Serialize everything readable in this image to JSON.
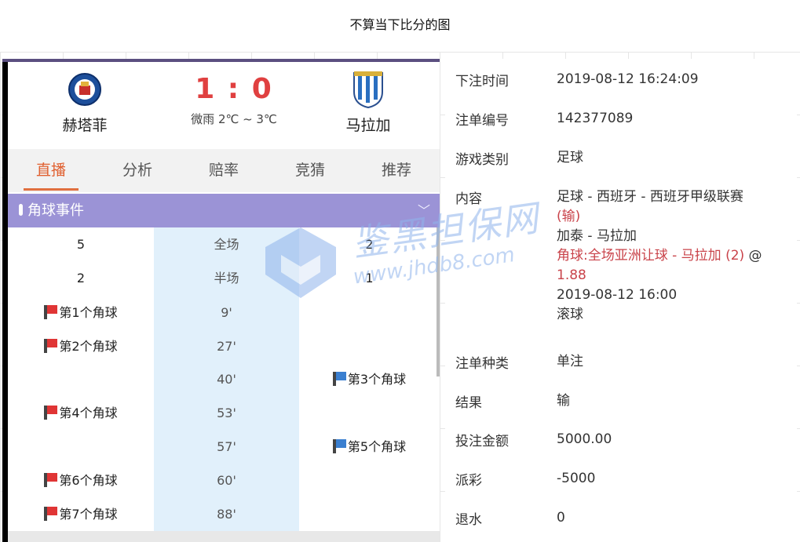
{
  "caption": "不算当下比分的图",
  "match": {
    "home_team": "赫塔菲",
    "away_team": "马拉加",
    "score": "1 : 0",
    "weather": "微雨  2℃ ~ 3℃"
  },
  "tabs": [
    {
      "label": "直播",
      "active": true
    },
    {
      "label": "分析",
      "active": false
    },
    {
      "label": "赔率",
      "active": false
    },
    {
      "label": "竞猜",
      "active": false
    },
    {
      "label": "推荐",
      "active": false
    }
  ],
  "section": {
    "title": "角球事件"
  },
  "corner_rows": [
    {
      "left": "5",
      "mid": "全场",
      "right": "2"
    },
    {
      "left": "2",
      "mid": "半场",
      "right": "1"
    },
    {
      "left_flag": "red",
      "left": "第1个角球",
      "mid": "9'",
      "right": ""
    },
    {
      "left_flag": "red",
      "left": "第2个角球",
      "mid": "27'",
      "right": ""
    },
    {
      "left": "",
      "mid": "40'",
      "right_flag": "blue",
      "right": "第3个角球"
    },
    {
      "left_flag": "red",
      "left": "第4个角球",
      "mid": "53'",
      "right": ""
    },
    {
      "left": "",
      "mid": "57'",
      "right_flag": "blue",
      "right": "第5个角球"
    },
    {
      "left_flag": "red",
      "left": "第6个角球",
      "mid": "60'",
      "right": ""
    },
    {
      "left_flag": "red",
      "left": "第7个角球",
      "mid": "88'",
      "right": ""
    }
  ],
  "watermark": {
    "text": "鉴黑担保网",
    "url": "www.jhdb8.com"
  },
  "bet": {
    "time_label": "下注时间",
    "time": "2019-08-12 16:24:09",
    "id_label": "注单编号",
    "id": "142377089",
    "game_label": "游戏类别",
    "game": "足球",
    "content_label": "内容",
    "content_league": "足球 - 西班牙 - 西班牙甲级联赛",
    "content_result": "(输)",
    "content_match": "加泰 - 马拉加",
    "content_pick": "角球:全场亚洲让球 - 马拉加 (2)",
    "content_at": " @",
    "content_odds": "1.88",
    "content_date": "2019-08-12 16:00",
    "content_type": "滚球",
    "kind_label": "注单种类",
    "kind": "单注",
    "result_label": "结果",
    "result": "输",
    "stake_label": "投注金额",
    "stake": "5000.00",
    "payout_label": "派彩",
    "payout": "-5000",
    "rebate_label": "退水",
    "rebate": "0"
  },
  "colors": {
    "score": "#e04040",
    "section_bar": "#9b93d6",
    "accent_tab": "#e06030",
    "loss_red": "#c9434a"
  }
}
